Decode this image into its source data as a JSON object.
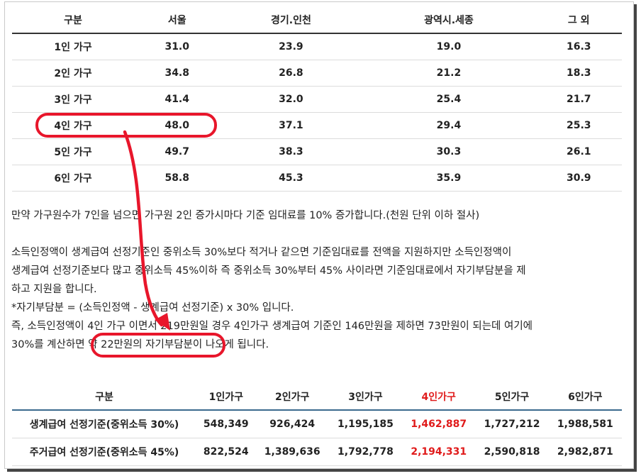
{
  "rent_table": {
    "headers": [
      "구분",
      "서울",
      "경기.인천",
      "광역시.세종",
      "그 외"
    ],
    "rows": [
      [
        "1인 가구",
        "31.0",
        "23.9",
        "19.0",
        "16.3"
      ],
      [
        "2인 가구",
        "34.8",
        "26.8",
        "21.2",
        "18.3"
      ],
      [
        "3인 가구",
        "41.4",
        "32.0",
        "25.4",
        "21.7"
      ],
      [
        "4인 가구",
        "48.0",
        "37.1",
        "29.4",
        "25.3"
      ],
      [
        "5인 가구",
        "49.7",
        "38.3",
        "30.3",
        "26.1"
      ],
      [
        "6인 가구",
        "58.8",
        "45.3",
        "35.9",
        "30.9"
      ]
    ]
  },
  "paragraphs": {
    "note": "만약 가구원수가 7인을 넘으면 가구원 2인 증가시마다 기준 임대료를 10% 증가합니다.(천원 단위 이하 절사)",
    "lines": [
      "소득인정액이 생계급여 선정기준인 중위소득 30%보다 적거나 같으면 기준임대료를 전액을 지원하지만 소득인정액이",
      "생계급여 선정기준보다 많고 중위소득 45%이하 즉 중위소득 30%부터 45% 사이라면 기준임대료에서 자기부담분을 제",
      "하고 지원을 합니다.",
      "*자기부담분 = (소득인정액 - 생계급여 선정기준) x 30% 입니다.",
      "즉, 소득인정액이 4인 가구 이면서 219만원일 경우 4인가구 생계급여 기준인 146만원을 제하면 73만원이 되는데 여기에",
      "30%를 계산하면 약 22만원의 자기부담분이 나오게 됩니다."
    ]
  },
  "criteria_table": {
    "headers": [
      "구분",
      "1인가구",
      "2인가구",
      "3인가구",
      "4인가구",
      "5인가구",
      "6인가구"
    ],
    "highlight_col": 4,
    "rows": [
      [
        "생계급여 선정기준(중위소득 30%)",
        "548,349",
        "926,424",
        "1,195,185",
        "1,462,887",
        "1,727,212",
        "1,988,581"
      ],
      [
        "주거급여 선정기준(중위소득 45%)",
        "822,524",
        "1,389,636",
        "1,792,778",
        "2,194,331",
        "2,590,818",
        "2,982,871"
      ]
    ]
  },
  "colors": {
    "annotation_red": "#e8162b",
    "highlight_text": "#e01b1b",
    "header_rule_blue": "#3a6a8e"
  }
}
